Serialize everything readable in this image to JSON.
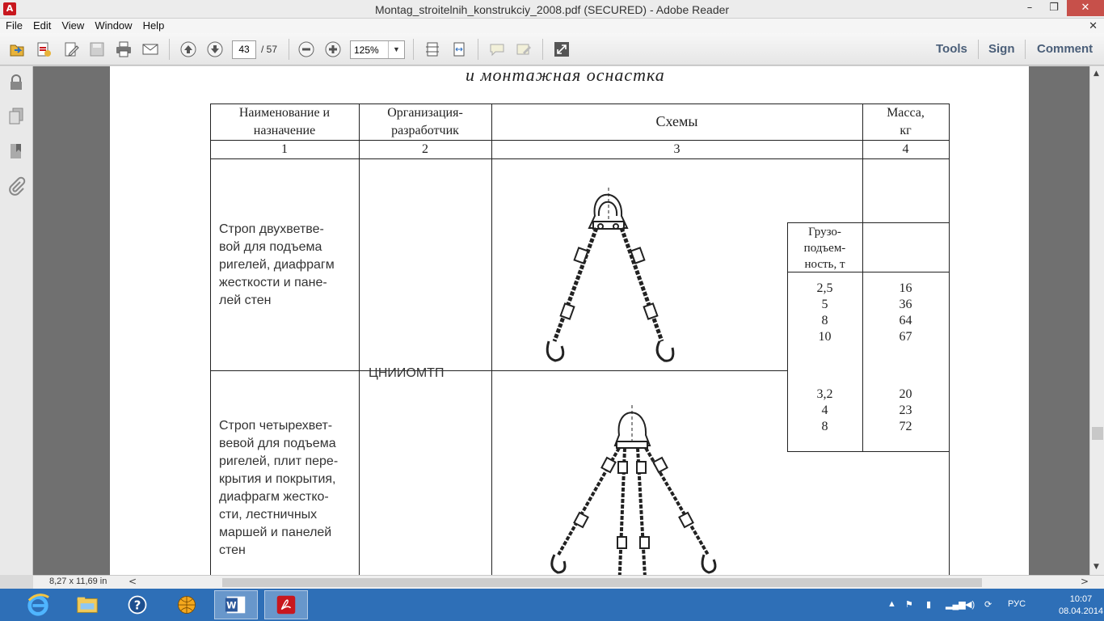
{
  "window": {
    "title": "Montag_stroitelnih_konstrukciy_2008.pdf (SECURED) - Adobe Reader",
    "minimize": "–",
    "restore": "❐",
    "close": "✕"
  },
  "menu": {
    "items": [
      "File",
      "Edit",
      "View",
      "Window",
      "Help"
    ],
    "close_doc": "✕"
  },
  "toolbar": {
    "current_page": "43",
    "total_pages": "/ 57",
    "zoom": "125%",
    "zoom_drop": "▼",
    "tools": "Tools",
    "sign": "Sign",
    "comment": "Comment"
  },
  "document": {
    "heading": "и монтажная оснастка",
    "table": {
      "headers": [
        "Наименование и назначение",
        "Организация-разработчик",
        "Схемы",
        "Масса, кг"
      ],
      "header_lines": {
        "h1a": "Наименование и",
        "h1b": "назначение",
        "h2a": "Организация-",
        "h2b": "разработчик",
        "h3": "Схемы",
        "h4a": "Масса,",
        "h4b": "кг"
      },
      "col_numbers": [
        "1",
        "2",
        "3",
        "4"
      ],
      "subheader": {
        "l1": "Грузо-",
        "l2": "подъем-",
        "l3": "ность, т"
      },
      "rows": [
        {
          "name_lines": [
            "Строп двухветве-",
            "вой для подъема",
            "ригелей, диафрагм",
            "жесткости и пане-",
            "лей стен"
          ],
          "capacity": [
            "2,5",
            "5",
            "8",
            "10"
          ],
          "mass": [
            "16",
            "36",
            "64",
            "67"
          ]
        },
        {
          "name_lines": [
            "Строп четырехвет-",
            "вевой для подъема",
            "ригелей, плит пере-",
            "крытия и покрытия,",
            "диафрагм жестко-",
            "сти, лестничных",
            "маршей и панелей",
            "стен"
          ],
          "capacity": [
            "3,2",
            "4",
            "8"
          ],
          "mass": [
            "20",
            "23",
            "72"
          ]
        }
      ],
      "organization": "ЦНИИОМТП"
    }
  },
  "status": {
    "page_size": "8,27 x 11,69 in",
    "left_arrow": "<",
    "right_arrow": ">"
  },
  "taskbar": {
    "language": "РУС",
    "time": "10:07",
    "date": "08.04.2014"
  }
}
